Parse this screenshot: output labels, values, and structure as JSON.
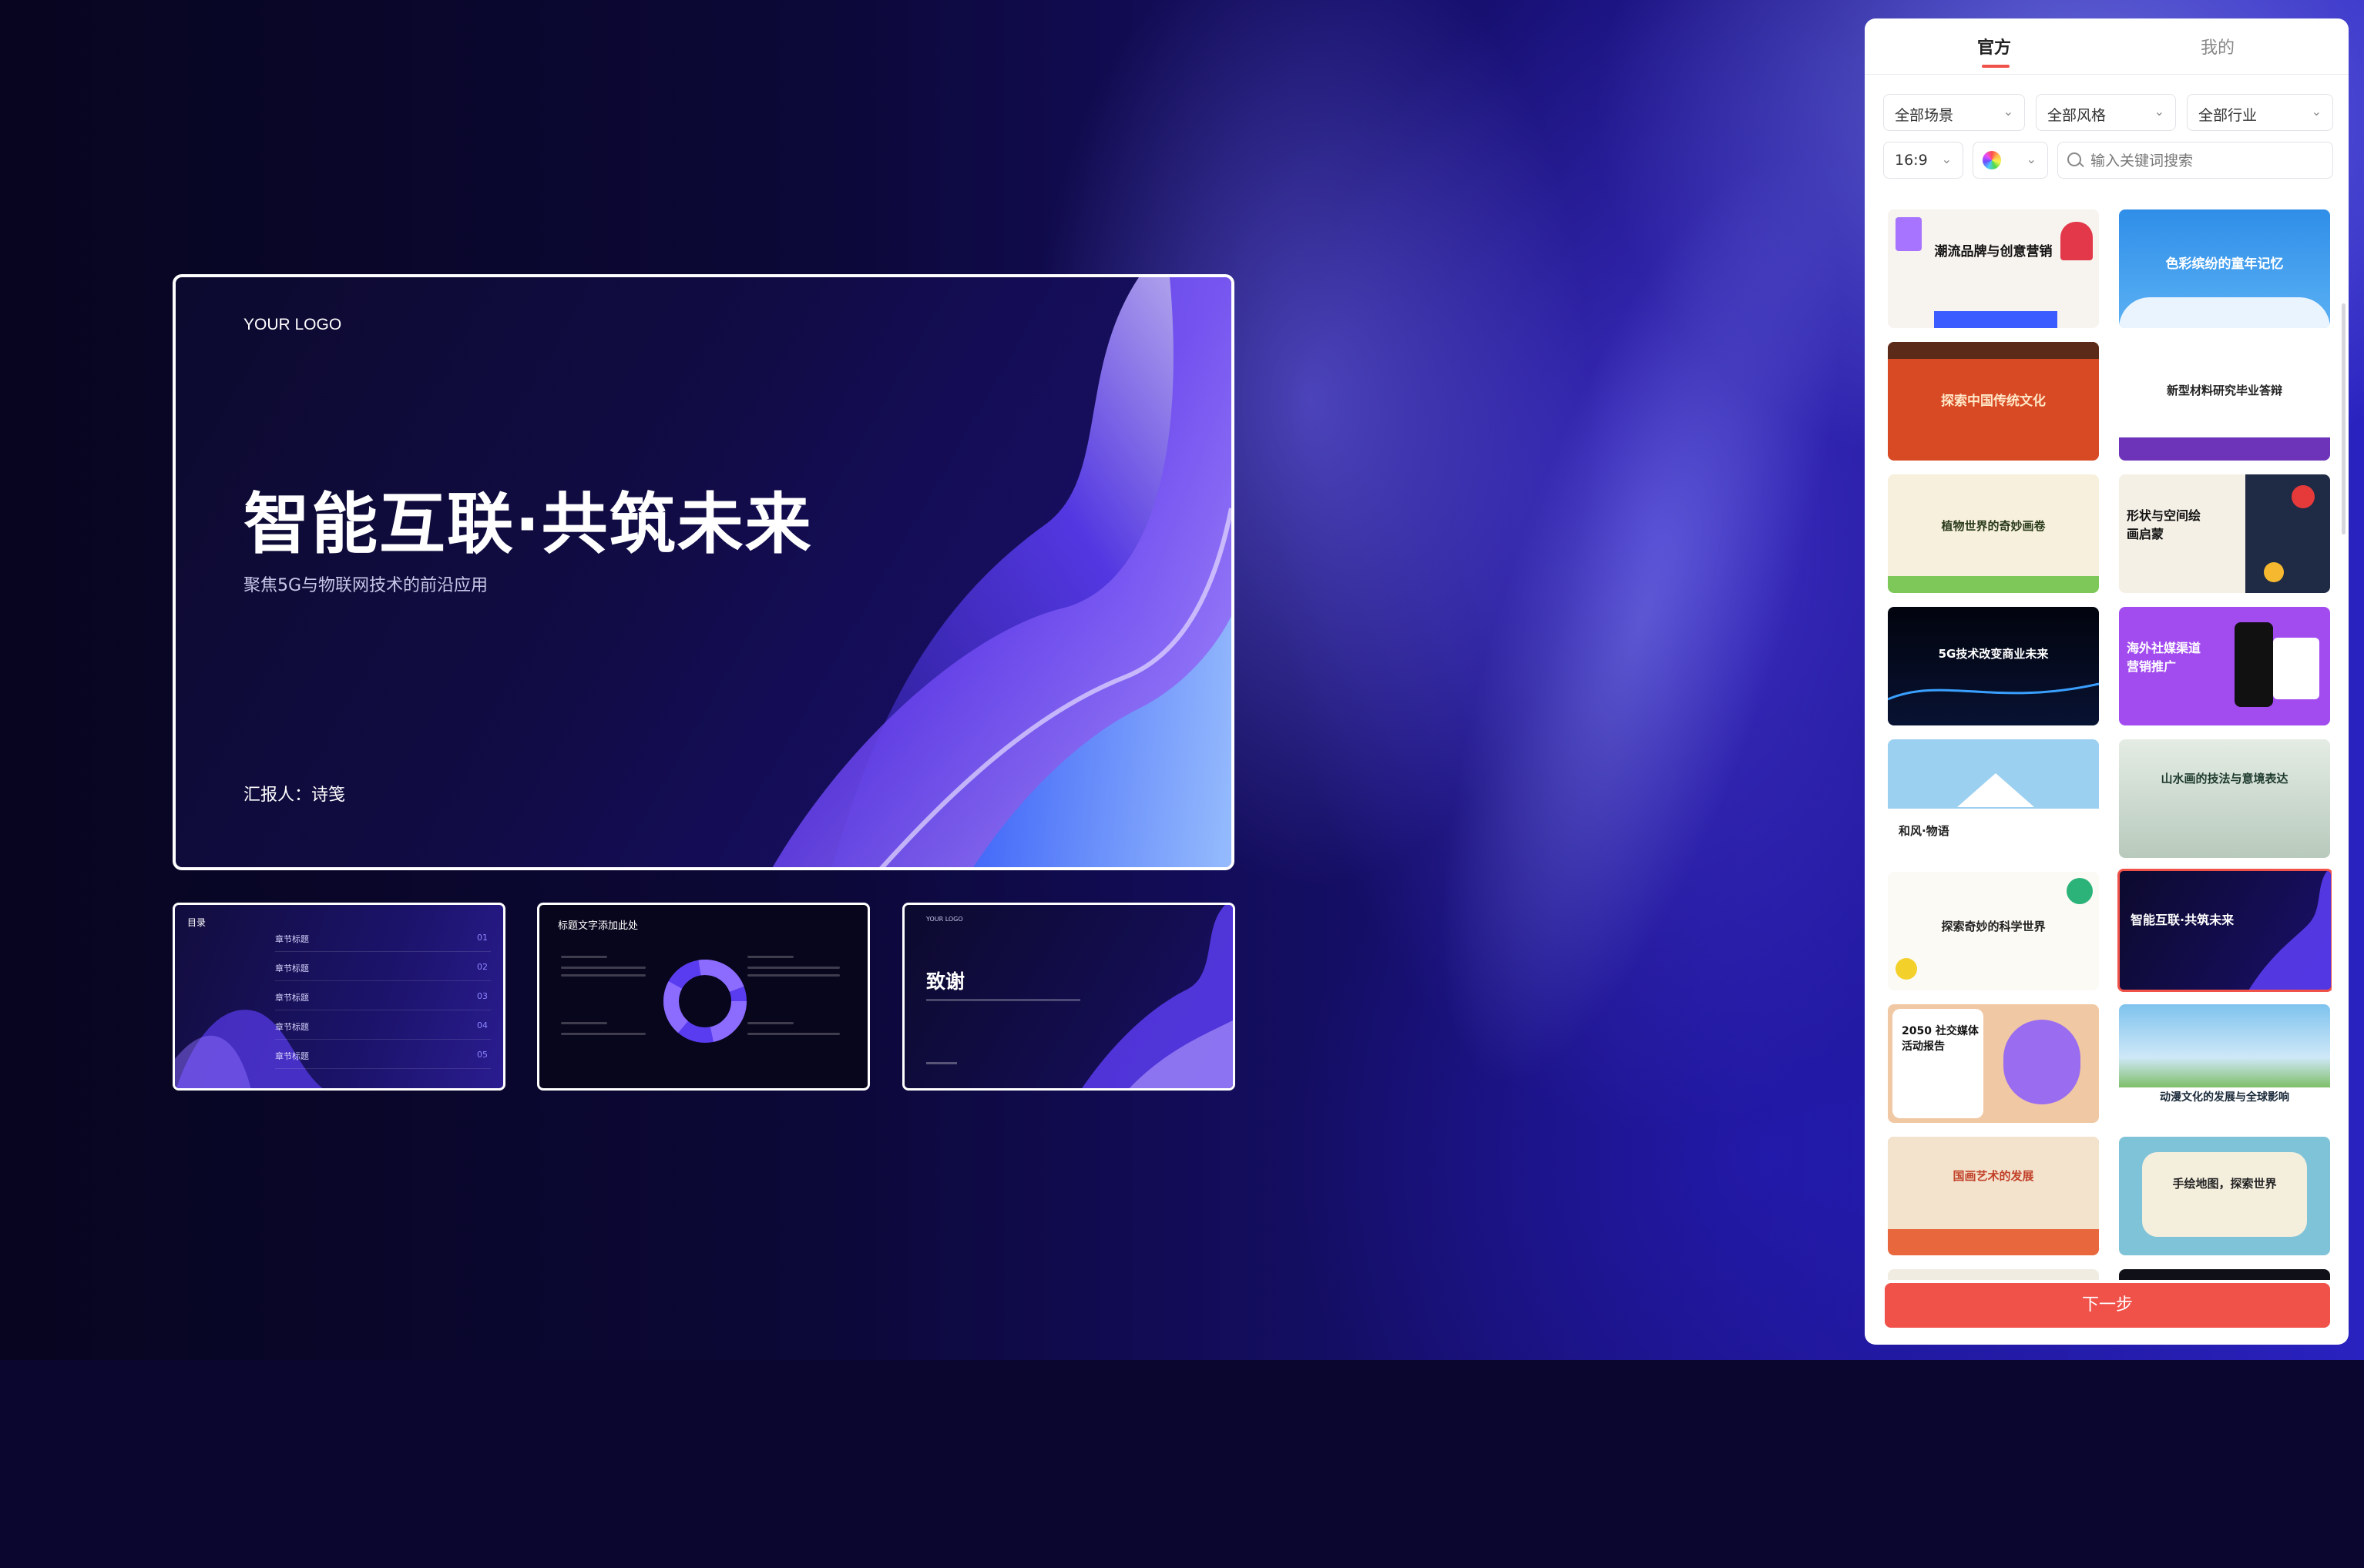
{
  "main_slide": {
    "logo": "YOUR LOGO",
    "title": "智能互联·共筑未来",
    "subtitle": "聚焦5G与物联网技术的前沿应用",
    "reporter": "汇报人：诗笺"
  },
  "thumbnails": {
    "toc": {
      "title": "目录",
      "rows": [
        {
          "label": "章节标题",
          "num": "01"
        },
        {
          "label": "章节标题",
          "num": "02"
        },
        {
          "label": "章节标题",
          "num": "03"
        },
        {
          "label": "章节标题",
          "num": "04"
        },
        {
          "label": "章节标题",
          "num": "05"
        }
      ]
    },
    "content": {
      "title": "标题文字添加此处"
    },
    "thanks": {
      "logo": "YOUR LOGO",
      "title": "致谢"
    }
  },
  "panel": {
    "tabs": {
      "official": "官方",
      "mine": "我的"
    },
    "filters": {
      "scene": "全部场景",
      "style": "全部风格",
      "industry": "全部行业",
      "ratio": "16:9"
    },
    "search": {
      "placeholder": "输入关键词搜索"
    },
    "templates": [
      {
        "title": "潮流品牌与创意营销"
      },
      {
        "title": "色彩缤纷的童年记忆"
      },
      {
        "title": "探索中国传统文化"
      },
      {
        "title": "新型材料研究毕业答辩"
      },
      {
        "title": "植物世界的奇妙画卷"
      },
      {
        "title": "形状与空间绘画启蒙"
      },
      {
        "title": "5G技术改变商业未来"
      },
      {
        "title": "海外社媒渠道营销推广"
      },
      {
        "title": "和风·物语"
      },
      {
        "title": "山水画的技法与意境表达"
      },
      {
        "title": "探索奇妙的科学世界"
      },
      {
        "title": "智能互联·共筑未来"
      },
      {
        "title": "2050 社交媒体活动报告"
      },
      {
        "title": "动漫文化的发展与全球影响"
      },
      {
        "title": "国画艺术的发展"
      },
      {
        "title": "手绘地图，探索世界"
      }
    ],
    "next_button": "下一步",
    "accent": "#f0524a"
  }
}
